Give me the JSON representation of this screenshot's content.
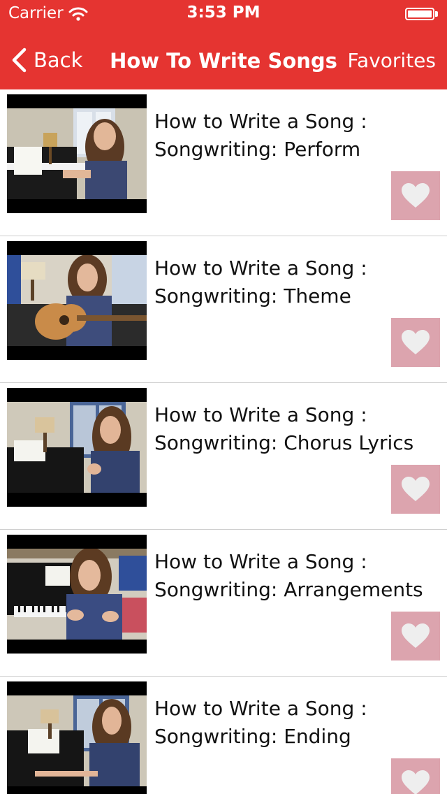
{
  "status_bar": {
    "carrier": "Carrier",
    "time": "3:53 PM",
    "wifi_icon": "wifi-icon",
    "battery_icon": "battery-icon"
  },
  "nav": {
    "back_label": "Back",
    "title": "How To Write Songs",
    "favorites_label": "Favorites"
  },
  "colors": {
    "header_bg": "#e53431",
    "heart_bg": "#dca4ae",
    "heart_fill": "#eeeeee"
  },
  "videos": [
    {
      "title_line1": "How to Write a Song :",
      "title_line2": "Songwriting: Perform",
      "favorite_icon": "heart-icon"
    },
    {
      "title_line1": "How to Write a Song :",
      "title_line2": "Songwriting: Theme",
      "favorite_icon": "heart-icon"
    },
    {
      "title_line1": "How to Write a Song :",
      "title_line2": "Songwriting: Chorus Lyrics",
      "favorite_icon": "heart-icon"
    },
    {
      "title_line1": "How to Write a Song :",
      "title_line2": "Songwriting: Arrangements",
      "favorite_icon": "heart-icon"
    },
    {
      "title_line1": "How to Write a Song :",
      "title_line2": "Songwriting: Ending",
      "favorite_icon": "heart-icon"
    }
  ]
}
